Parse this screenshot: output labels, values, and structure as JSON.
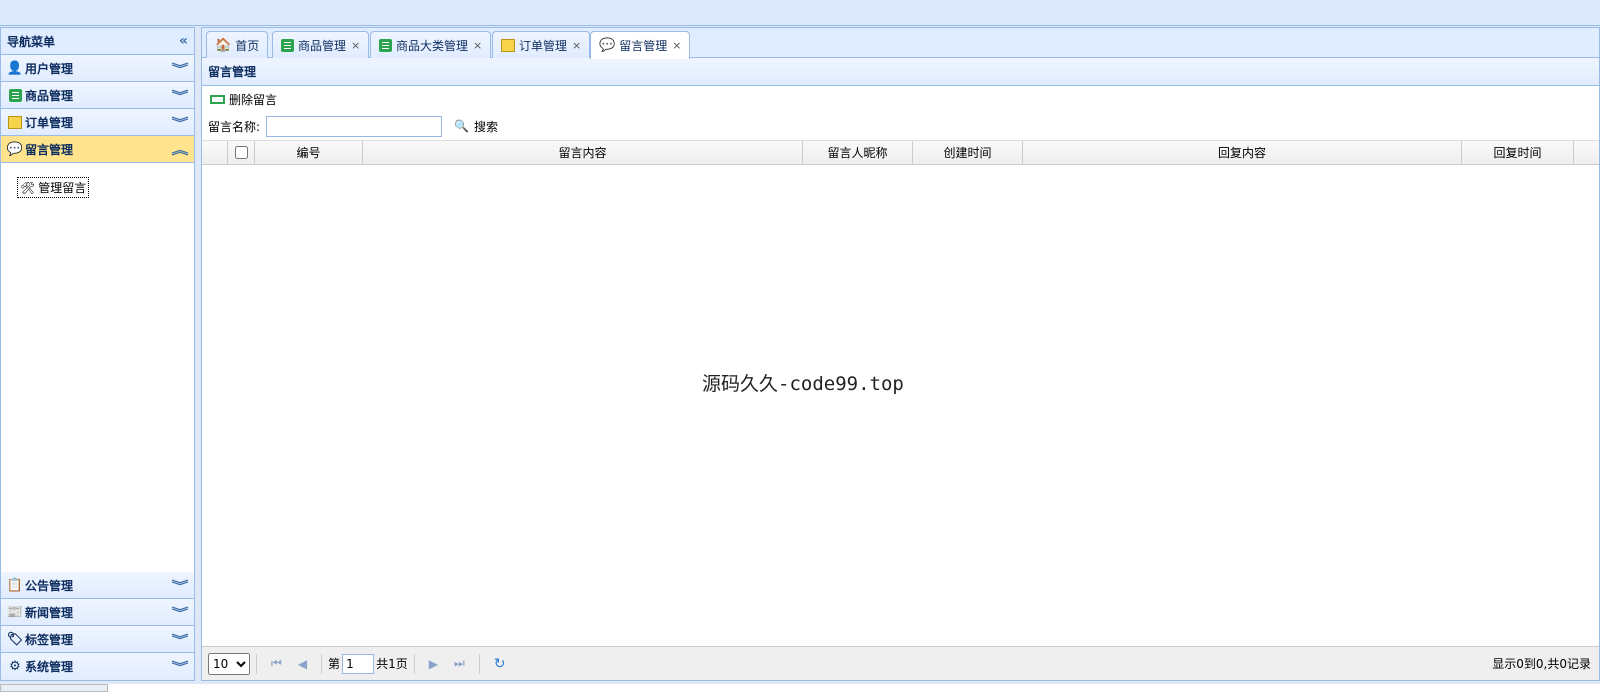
{
  "nav": {
    "title": "导航菜单",
    "collapse_icon": "double-chevron-left-icon",
    "sections_top": [
      {
        "label": "用户管理",
        "icon": "user-icon"
      },
      {
        "label": "商品管理",
        "icon": "list-icon"
      },
      {
        "label": "订单管理",
        "icon": "order-icon"
      },
      {
        "label": "留言管理",
        "icon": "speech-bubble-icon",
        "active": true
      }
    ],
    "active_links": [
      {
        "label": "管理留言",
        "icon": "tools-icon"
      }
    ],
    "sections_bottom": [
      {
        "label": "公告管理",
        "icon": "notice-icon"
      },
      {
        "label": "新闻管理",
        "icon": "news-icon"
      },
      {
        "label": "标签管理",
        "icon": "tag-icon"
      },
      {
        "label": "系统管理",
        "icon": "gear-icon"
      }
    ]
  },
  "tabs": [
    {
      "label": "首页",
      "icon": "home-icon",
      "closable": false
    },
    {
      "label": "商品管理",
      "icon": "list-icon",
      "closable": true
    },
    {
      "label": "商品大类管理",
      "icon": "list-icon",
      "closable": true
    },
    {
      "label": "订单管理",
      "icon": "order-icon",
      "closable": true
    },
    {
      "label": "留言管理",
      "icon": "speech-bubble-icon",
      "closable": true,
      "active": true
    }
  ],
  "panel": {
    "title": "留言管理",
    "delete_label": "删除留言",
    "search_label": "留言名称:",
    "search_value": "",
    "search_button": "搜索"
  },
  "grid": {
    "columns": [
      "编号",
      "留言内容",
      "留言人昵称",
      "创建时间",
      "回复内容",
      "回复时间"
    ],
    "rows": []
  },
  "watermark": "源码久久-code99.top",
  "pager": {
    "page_size": "10",
    "page_prefix": "第",
    "page_value": "1",
    "page_total": "共1页",
    "info": "显示0到0,共0记录"
  },
  "colors": {
    "border": "#99bbe8",
    "header_bg": "#e0ecff",
    "active_accordion": "#ffe48d"
  }
}
